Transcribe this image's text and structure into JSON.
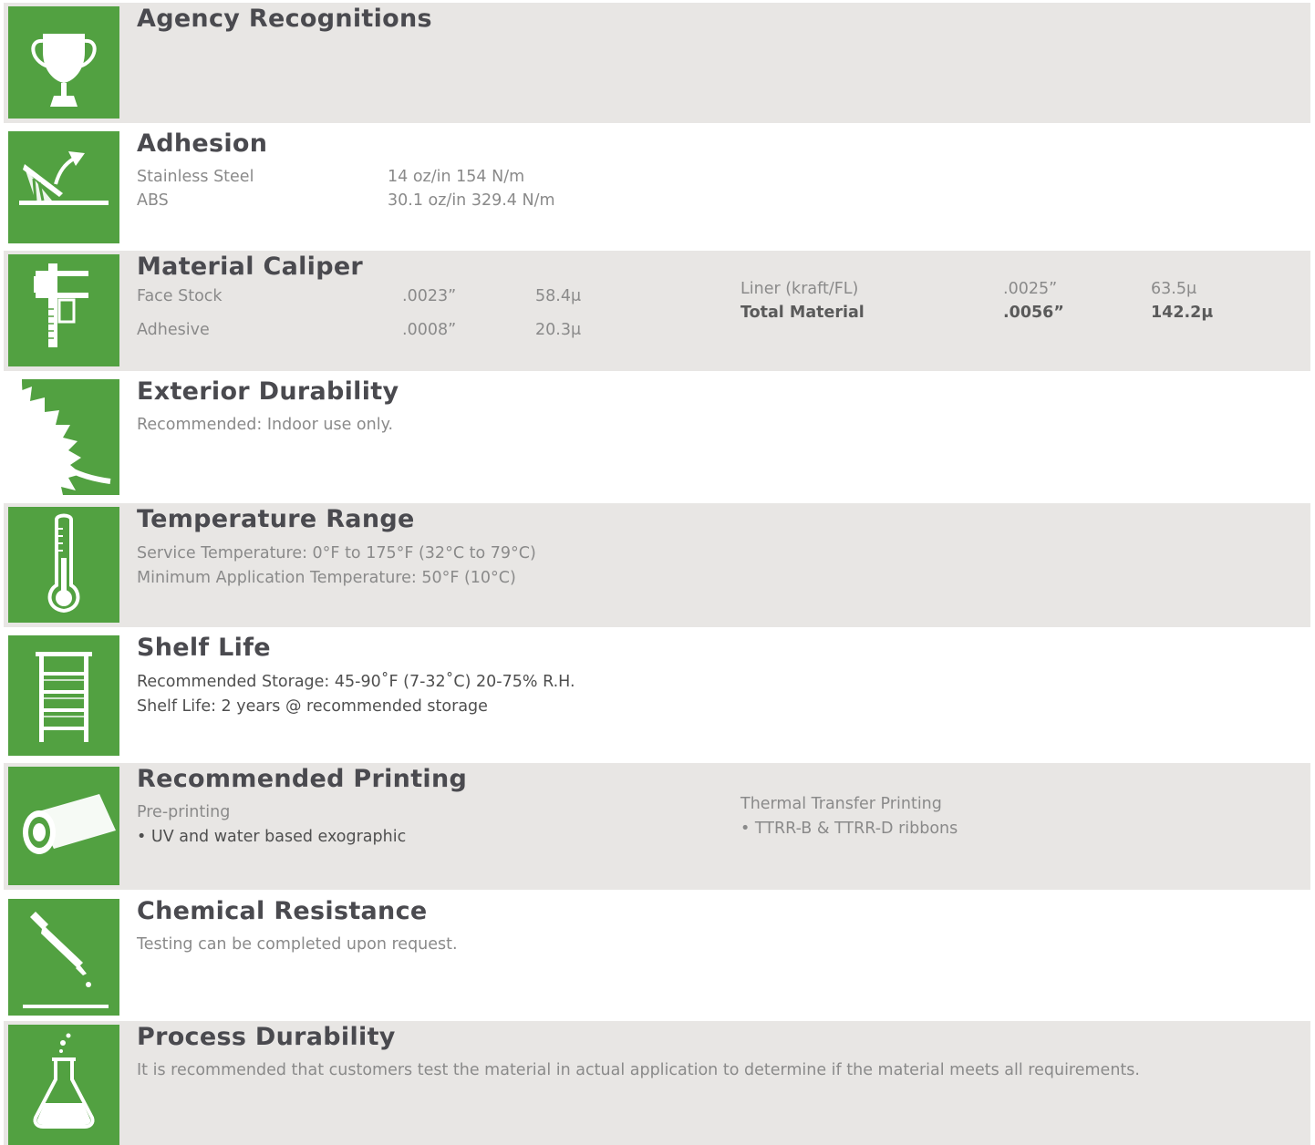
{
  "sections": {
    "agency": {
      "title": "Agency Recognitions",
      "icon": "trophy-icon"
    },
    "adhesion": {
      "title": "Adhesion",
      "icon": "peel-test-icon",
      "rows": [
        {
          "label": "Stainless Steel",
          "value": "14 oz/in 154 N/m"
        },
        {
          "label": "ABS",
          "value": "30.1 oz/in 329.4 N/m"
        }
      ]
    },
    "caliper": {
      "title": "Material Caliper",
      "icon": "caliper-icon",
      "left": [
        {
          "label": "Face Stock",
          "in": ".0023”",
          "mu": "58.4μ"
        },
        {
          "label": "Adhesive",
          "in": ".0008”",
          "mu": "20.3μ"
        }
      ],
      "right": [
        {
          "label": "Liner (kraft/FL)",
          "in": ".0025”",
          "mu": "63.5μ"
        },
        {
          "label": "Total Material",
          "in": ".0056”",
          "mu": "142.2μ"
        }
      ]
    },
    "exterior": {
      "title": "Exterior Durability",
      "icon": "sun-icon",
      "text": "Recommended: Indoor use only."
    },
    "temperature": {
      "title": "Temperature Range",
      "icon": "thermometer-icon",
      "line1": "Service Temperature: 0°F to 175°F (32°C to 79°C)",
      "line2": "Minimum Application Temperature: 50°F (10°C)"
    },
    "shelf": {
      "title": "Shelf Life",
      "icon": "shelf-icon",
      "line1": "Recommended Storage: 45-90˚F (7-32˚C) 20-75% R.H.",
      "line2": "Shelf Life: 2 years @ recommended storage"
    },
    "printing": {
      "title": "Recommended Printing",
      "icon": "roll-icon",
      "left_head": "Pre-printing",
      "left_item": "• UV and water based exographic",
      "right_head": "Thermal Transfer Printing",
      "right_item": "• TTRR-B & TTRR-D ribbons"
    },
    "chemical": {
      "title": "Chemical Resistance",
      "icon": "dropper-icon",
      "text": "Testing can be completed upon request."
    },
    "process": {
      "title": "Process Durability",
      "icon": "flask-icon",
      "text": "It is recommended that customers test the material in actual application to determine if the material meets all requirements."
    }
  },
  "colors": {
    "accent": "#52a141",
    "band": "#e8e6e4",
    "heading": "#4a4a4f",
    "body": "#8a8a8a"
  }
}
